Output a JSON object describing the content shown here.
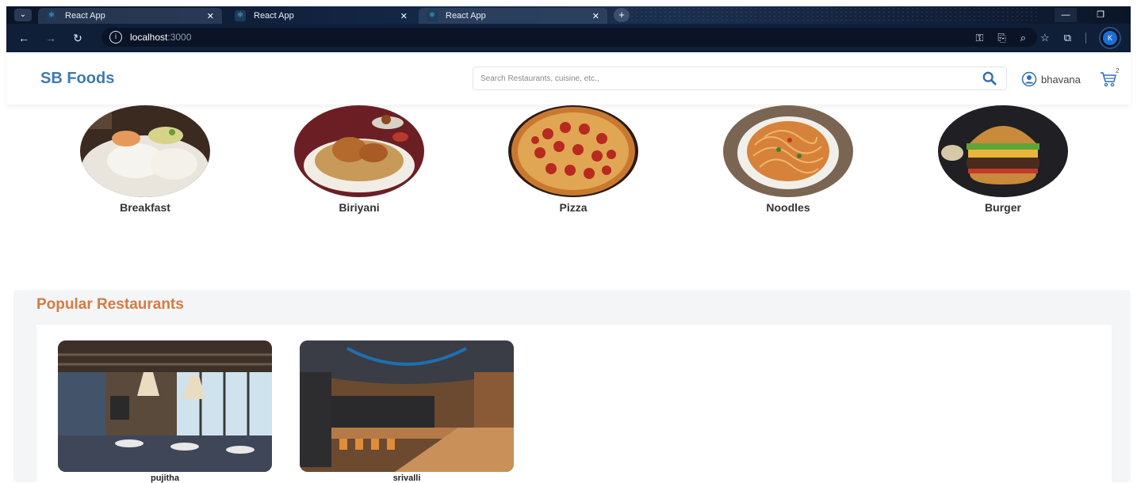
{
  "browser": {
    "tabs": [
      {
        "title": "React App"
      },
      {
        "title": "React App"
      },
      {
        "title": "React App"
      }
    ],
    "url_host": "localhost",
    "url_port": ":3000",
    "profile_initial": "K"
  },
  "header": {
    "logo": "SB Foods",
    "search_placeholder": "Search Restaurants, cuisine, etc.,",
    "username": "bhavana",
    "cart_count": "2"
  },
  "categories": [
    {
      "label": "Breakfast"
    },
    {
      "label": "Biriyani"
    },
    {
      "label": "Pizza"
    },
    {
      "label": "Noodles"
    },
    {
      "label": "Burger"
    }
  ],
  "popular": {
    "title": "Popular Restaurants",
    "restaurants": [
      {
        "name": "pujitha"
      },
      {
        "name": "srivalli"
      }
    ]
  },
  "colors": {
    "logo": "#3e7bb0",
    "popular_title": "#d77b3f",
    "search_icon": "#2f6fb3"
  }
}
